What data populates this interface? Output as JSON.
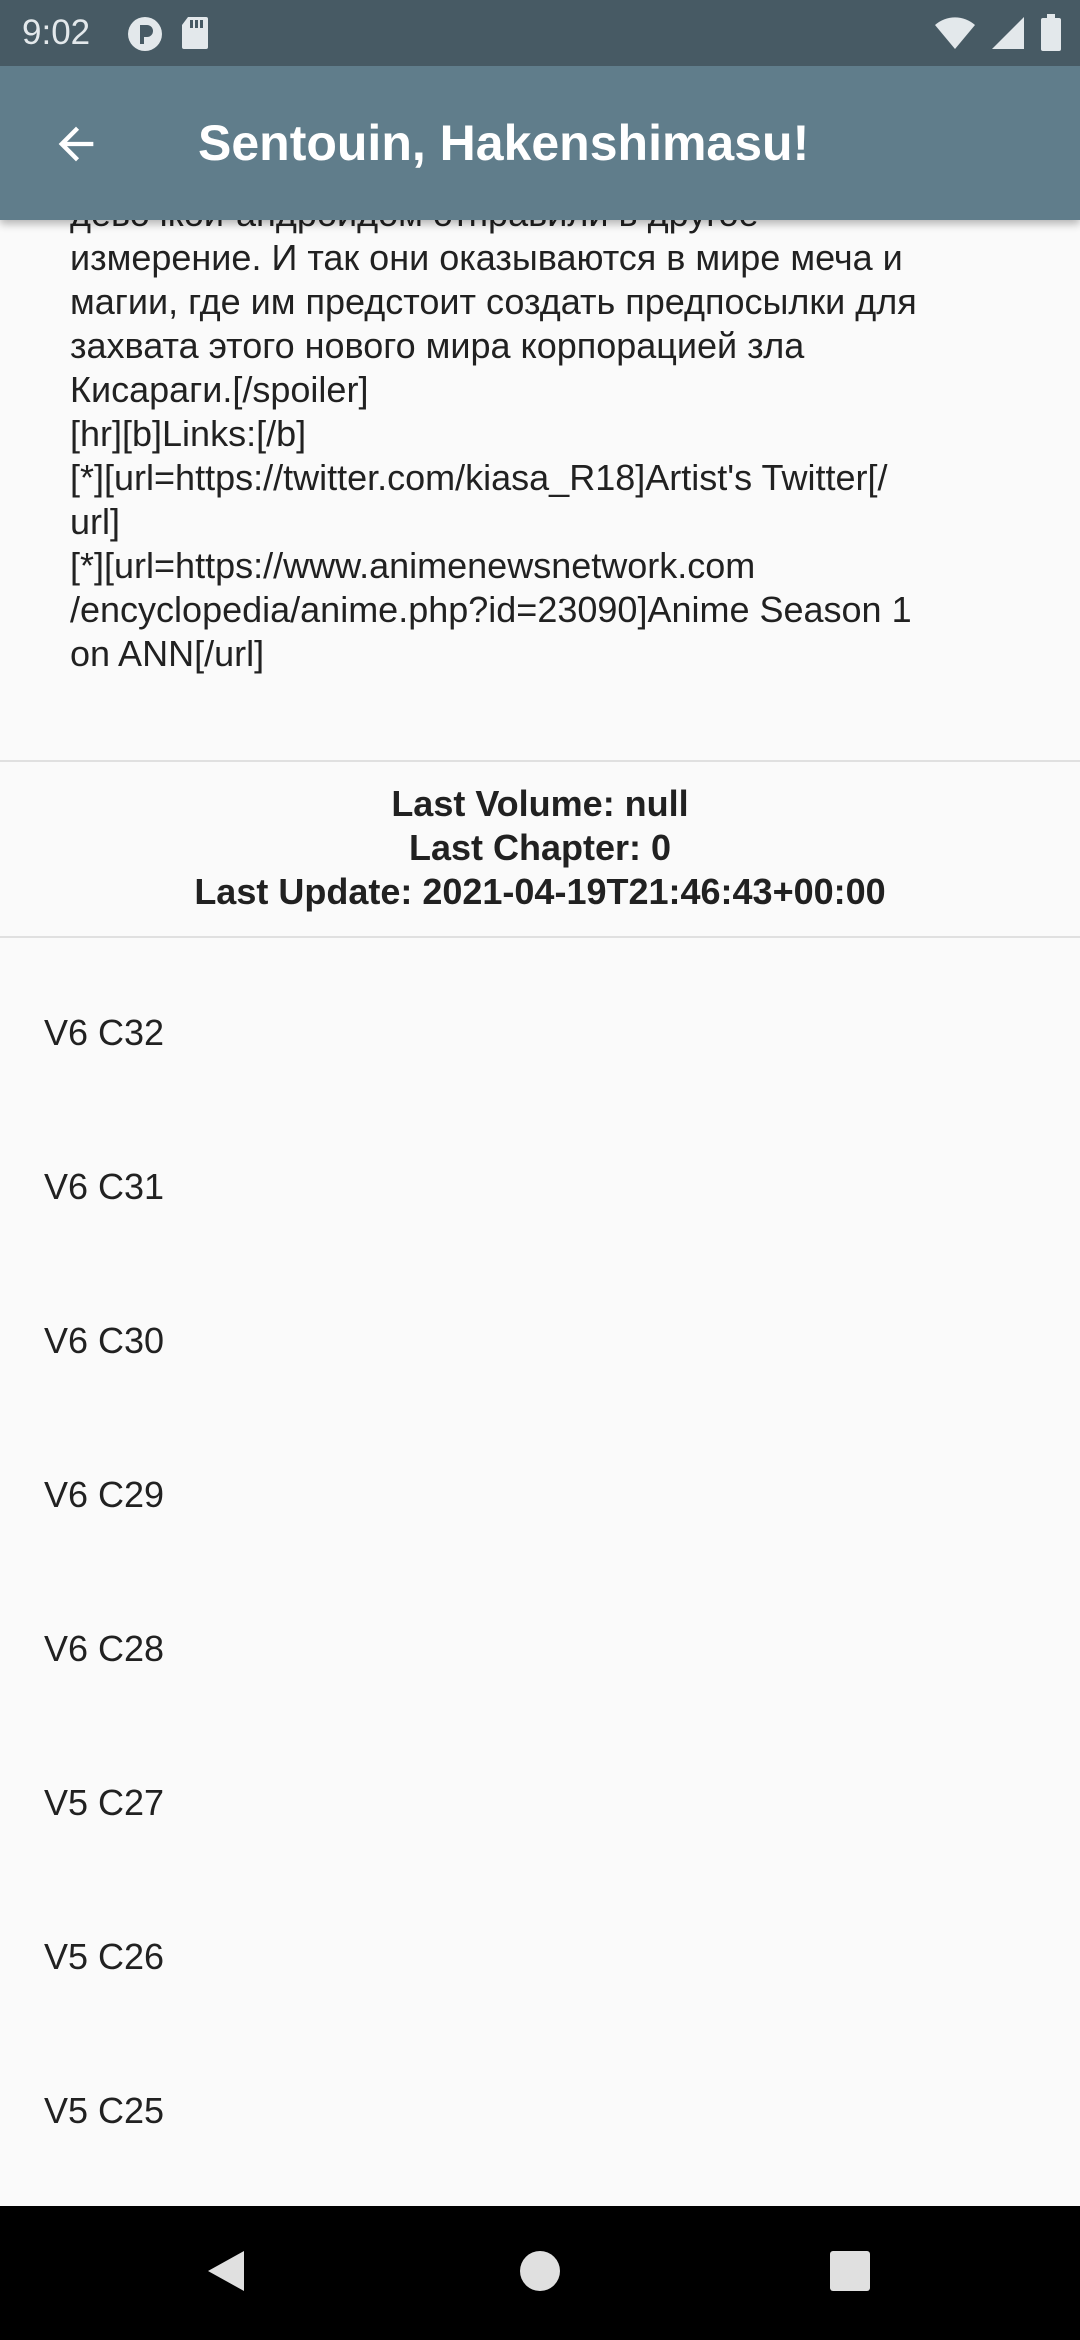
{
  "status_bar": {
    "time": "9:02",
    "left_icons": [
      "notification-p-icon",
      "sd-card-icon"
    ],
    "right_icons": [
      "wifi-icon",
      "cell-signal-icon",
      "battery-icon"
    ]
  },
  "app_bar": {
    "title": "Sentouin, Hakenshimasu!",
    "back_icon": "arrow-back-icon",
    "color": "#607d8b"
  },
  "description": {
    "text": "девочкой-андроидом отправили в другое\nизмерение. И так они оказываются в мире меча и\nмагии, где им предстоит создать предпосылки для\nзахвата этого нового мира корпорацией зла\nКисараги.[/spoiler]\n[hr][b]Links:[/b]\n[*][url=https://twitter.com/kiasa_R18]Artist's Twitter[/\nurl]\n[*][url=https://www.animenewsnetwork.com\n/encyclopedia/anime.php?id=23090]Anime Season 1\non ANN[/url]"
  },
  "info": {
    "last_volume": "Last Volume: null",
    "last_chapter": "Last Chapter: 0",
    "last_update": "Last Update: 2021-04-19T21:46:43+00:00"
  },
  "chapters": [
    {
      "label": "V6 C32"
    },
    {
      "label": "V6 C31"
    },
    {
      "label": "V6 C30"
    },
    {
      "label": "V6 C29"
    },
    {
      "label": "V6 C28"
    },
    {
      "label": "V5 C27"
    },
    {
      "label": "V5 C26"
    },
    {
      "label": "V5 C25"
    }
  ],
  "nav_bar": {
    "icons": [
      "back-triangle-icon",
      "home-circle-icon",
      "recents-square-icon"
    ]
  }
}
